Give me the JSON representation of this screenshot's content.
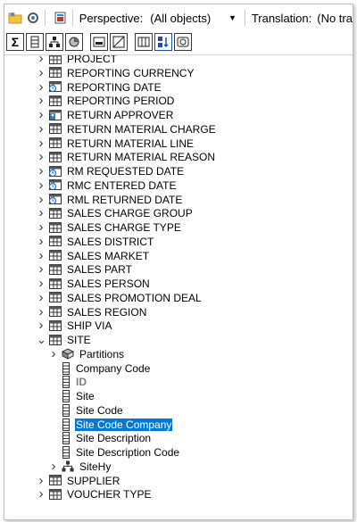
{
  "toolbar": {
    "perspective_label": "Perspective:",
    "perspective_value": "(All objects)",
    "translation_label": "Translation:",
    "translation_value": "(No tra"
  },
  "icons": {
    "sigma": "Σ",
    "db": "⊟",
    "hier": "⁂",
    "cube": "◈",
    "grid": "▦",
    "chart": "▣",
    "cols": "▥",
    "sort": "⇅",
    "link": "⊕"
  },
  "tree": {
    "dimensions": [
      {
        "label": "PROJECT",
        "icon": "table-icon"
      },
      {
        "label": "REPORTING CURRENCY",
        "icon": "table-icon"
      },
      {
        "label": "REPORTING DATE",
        "icon": "date-table-icon"
      },
      {
        "label": "REPORTING PERIOD",
        "icon": "table-icon"
      },
      {
        "label": "RETURN APPROVER",
        "icon": "user-table-icon"
      },
      {
        "label": "RETURN MATERIAL CHARGE",
        "icon": "table-icon"
      },
      {
        "label": "RETURN MATERIAL LINE",
        "icon": "table-icon"
      },
      {
        "label": "RETURN MATERIAL REASON",
        "icon": "table-icon"
      },
      {
        "label": "RM REQUESTED DATE",
        "icon": "date-table-icon"
      },
      {
        "label": "RMC ENTERED DATE",
        "icon": "date-table-icon"
      },
      {
        "label": "RML RETURNED DATE",
        "icon": "date-table-icon"
      },
      {
        "label": "SALES CHARGE GROUP",
        "icon": "table-icon"
      },
      {
        "label": "SALES CHARGE TYPE",
        "icon": "table-icon"
      },
      {
        "label": "SALES DISTRICT",
        "icon": "table-icon"
      },
      {
        "label": "SALES MARKET",
        "icon": "table-icon"
      },
      {
        "label": "SALES PART",
        "icon": "table-icon"
      },
      {
        "label": "SALES PERSON",
        "icon": "table-icon"
      },
      {
        "label": "SALES PROMOTION DEAL",
        "icon": "table-icon"
      },
      {
        "label": "SALES REGION",
        "icon": "table-icon"
      },
      {
        "label": "SHIP VIA",
        "icon": "table-icon"
      }
    ],
    "site": {
      "label": "SITE",
      "partitions": "Partitions",
      "attributes": [
        {
          "label": "Company Code",
          "style": "normal"
        },
        {
          "label": "ID",
          "style": "grey"
        },
        {
          "label": "Site",
          "style": "normal"
        },
        {
          "label": "Site Code",
          "style": "normal"
        },
        {
          "label": "Site Code Company",
          "style": "selected"
        },
        {
          "label": "Site Description",
          "style": "normal"
        },
        {
          "label": "Site Description Code",
          "style": "normal"
        }
      ],
      "hierarchy": "SiteHy"
    },
    "after": [
      {
        "label": "SUPPLIER",
        "icon": "table-icon"
      },
      {
        "label": "VOUCHER TYPE",
        "icon": "table-icon"
      }
    ]
  }
}
